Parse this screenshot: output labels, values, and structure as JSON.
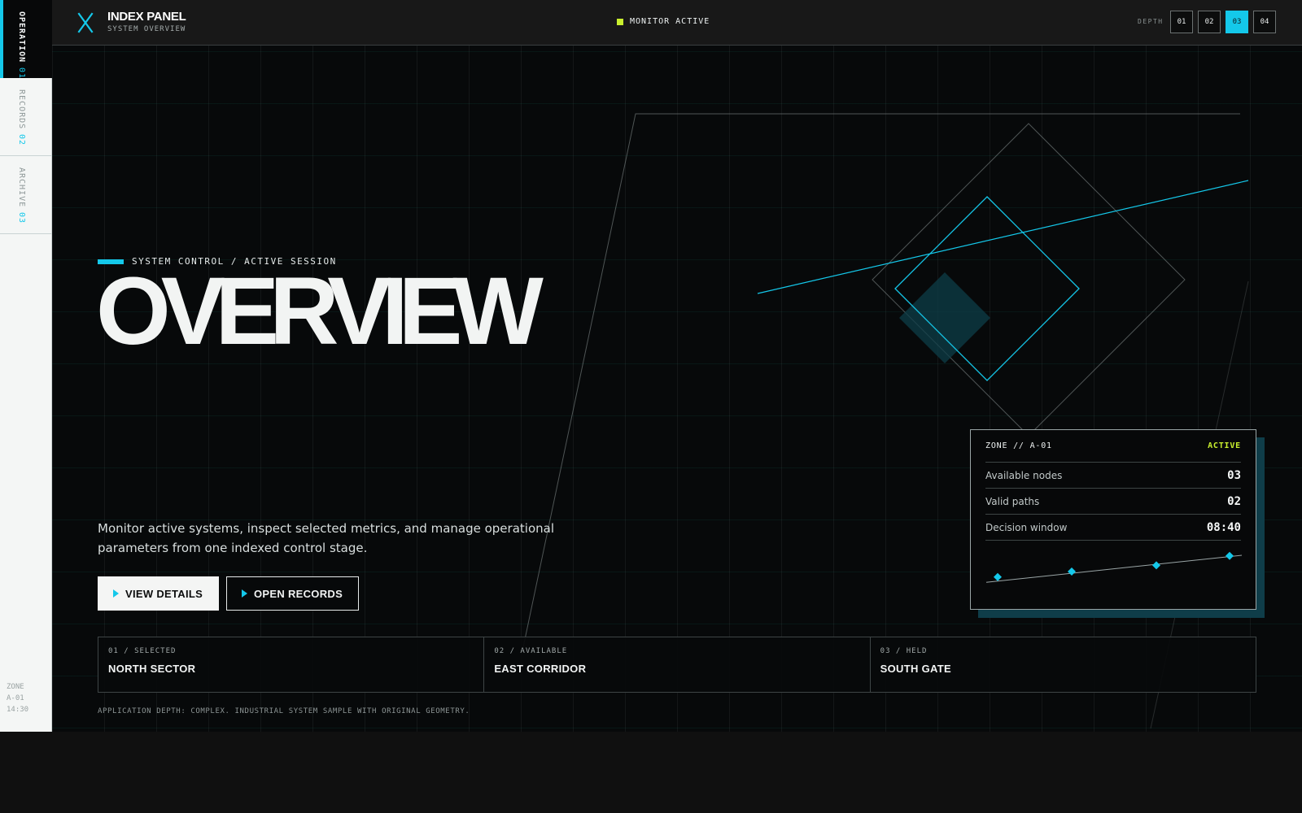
{
  "sidebar": {
    "items": [
      {
        "num": "01",
        "label": "OPERATION",
        "active": true
      },
      {
        "num": "02",
        "label": "RECORDS",
        "active": false
      },
      {
        "num": "03",
        "label": "ARCHIVE",
        "active": false
      }
    ],
    "footer": {
      "zone_label": "ZONE",
      "zone_id": "A-01",
      "time": "14:30"
    }
  },
  "topbar": {
    "brand_title": "INDEX PANEL",
    "brand_subtitle": "SYSTEM OVERVIEW",
    "status_text": "MONITOR ACTIVE",
    "status_color": "#c9ef2e",
    "depth_label": "DEPTH",
    "depth_options": [
      "01",
      "02",
      "03",
      "04"
    ],
    "depth_selected": "03",
    "logo_icon": "x-logo-icon"
  },
  "hero": {
    "eyebrow": "SYSTEM CONTROL / ACTIVE SESSION",
    "title": "OVERVIEW",
    "description": "Monitor active systems, inspect selected metrics, and manage operational parameters from one indexed control stage.",
    "primary_button": "VIEW DETAILS",
    "secondary_button": "OPEN RECORDS",
    "button_icon": "play-triangle-icon"
  },
  "sectors": [
    {
      "tag": "01 / SELECTED",
      "name": "NORTH SECTOR"
    },
    {
      "tag": "02 / AVAILABLE",
      "name": "EAST CORRIDOR"
    },
    {
      "tag": "03 / HELD",
      "name": "SOUTH GATE"
    }
  ],
  "footnote": "APPLICATION DEPTH: COMPLEX. INDUSTRIAL SYSTEM SAMPLE WITH ORIGINAL GEOMETRY.",
  "zone_card": {
    "zone": "ZONE // A-01",
    "status": "ACTIVE",
    "rows": [
      {
        "label": "Available nodes",
        "value": "03"
      },
      {
        "label": "Valid paths",
        "value": "02"
      },
      {
        "label": "Decision window",
        "value": "08:40"
      }
    ],
    "sparkline_values": [
      0.28,
      0.45,
      0.64,
      0.93
    ]
  },
  "colors": {
    "accent": "#14c8ea",
    "status_lime": "#c9ef2e",
    "stage_bg": "#07090a",
    "card_shadow": "#0f3d49"
  }
}
